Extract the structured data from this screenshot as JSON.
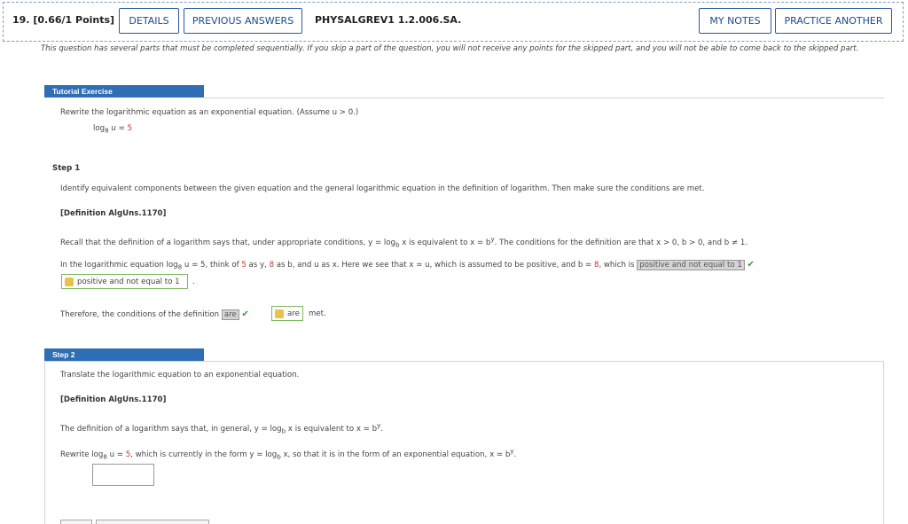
{
  "header": {
    "question_number": "19.",
    "points": "[0.66/1 Points]",
    "details_label": "DETAILS",
    "previous_answers_label": "PREVIOUS ANSWERS",
    "question_id": "PHYSALGREV1 1.2.006.SA.",
    "my_notes_label": "MY NOTES",
    "practice_another_label": "PRACTICE ANOTHER"
  },
  "intro": "This question has several parts that must be completed sequentially. If you skip a part of the question, you will not receive any points for the skipped part, and you will not be able to come back to the skipped part.",
  "tutorial": {
    "banner": "Tutorial Exercise",
    "prompt": "Rewrite the logarithmic equation as an exponential equation. (Assume u > 0.)",
    "equation_base": "log",
    "equation_sub": "8",
    "equation_rest": " u = ",
    "equation_value": "5"
  },
  "step1": {
    "label": "Step 1",
    "instruction": "Identify equivalent components between the given equation and the general logarithmic equation in the definition of logarithm. Then make sure the conditions are met.",
    "definition": "[Definition AlgUns.1170]",
    "recall_text": "Recall that the definition of a logarithm says that, under appropriate conditions, y = log",
    "recall_sub": "b",
    "recall_rest": " x is equivalent to x = b",
    "recall_sup": "y",
    "recall_end": ". The conditions for the definition are that x > 0, b > 0, and b ≠ 1.",
    "in_text_1": "In the logarithmic equation log",
    "in_sub": "8",
    "in_text_2": " u = 5, think of ",
    "in_5": "5",
    "in_text_3": " as y, ",
    "in_8": "8",
    "in_text_4": " as b, and u as x. Here we see that x = u, which is assumed to be positive, and b = ",
    "in_8b": "8",
    "in_text_5": ", which is ",
    "given_answer_1": "positive and not equal to 1",
    "key_answer_1": "positive and not equal to 1",
    "therefore_text": "Therefore, the conditions of the definition",
    "given_answer_2": "are",
    "key_answer_2": "are",
    "met_text": "met."
  },
  "step2": {
    "label": "Step 2",
    "instruction": "Translate the logarithmic equation to an exponential equation.",
    "definition": "[Definition AlgUns.1170]",
    "def_text_1": "The definition of a logarithm says that, in general, y = log",
    "def_sub": "b",
    "def_text_2": " x is equivalent to x = b",
    "def_sup": "y",
    "def_text_3": ".",
    "rewrite_1": "Rewrite log",
    "rewrite_sub": "8",
    "rewrite_2": " u = ",
    "rewrite_5": "5",
    "rewrite_3": ", which is currently in the form y = log",
    "rewrite_sub2": "b",
    "rewrite_4": " x, so that it is in the form of an exponential equation, x = b",
    "rewrite_sup": "y",
    "rewrite_5b": "."
  }
}
